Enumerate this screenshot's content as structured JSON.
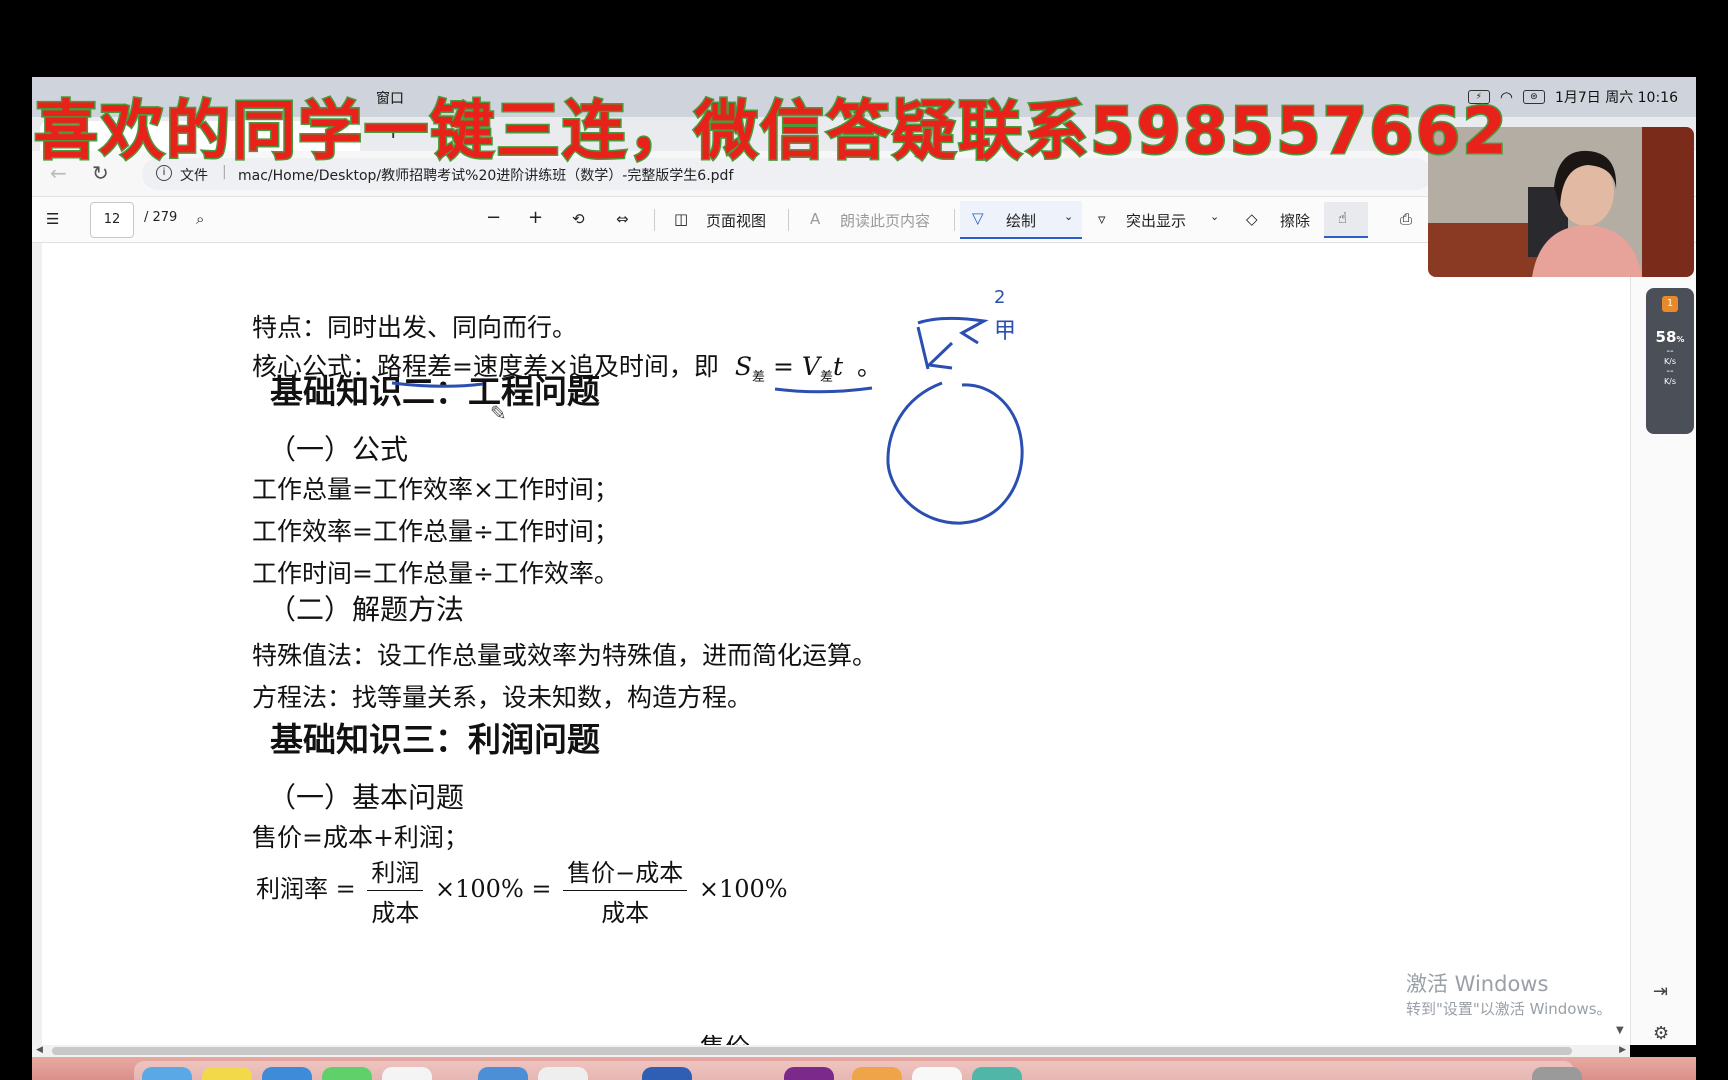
{
  "banner": {
    "text": "喜欢的同学一键三连，微信答疑联系598557662",
    "fill_color": "#e8221b",
    "outline_color": "#4a9a3c"
  },
  "menubar": {
    "window_menu": "窗口",
    "status_icons": [
      "battery-icon",
      "wifi-icon",
      "control-center-icon"
    ],
    "datetime": "1月7日 周六 10:16"
  },
  "browser": {
    "file_label": "文件",
    "url": "mac/Home/Desktop/教师招聘考试%20进阶讲练班（数学）-完整版学生6.pdf"
  },
  "pdf_toolbar": {
    "current_page": "12",
    "total_pages": "/ 279",
    "page_view": "页面视图",
    "read_aloud": "朗读此页内容",
    "draw": "绘制",
    "highlight": "突出显示",
    "erase": "擦除"
  },
  "document": {
    "feature_line": "特点：同时出发、同向而行。",
    "core_formula_prefix": "核心公式：",
    "core_formula_underlined": "路程差",
    "core_formula_rest": "=速度差×追及时间，即",
    "core_formula_math_S": "S",
    "core_formula_math_sub": "差",
    "core_formula_math_eq": " = V",
    "core_formula_math_sub2": "差",
    "core_formula_math_t": "t",
    "core_formula_end": "。",
    "section2_title": "基础知识二：工程问题",
    "s2_sub1": "（一）公式",
    "s2_line1": "工作总量=工作效率×工作时间；",
    "s2_line2": "工作效率=工作总量÷工作时间；",
    "s2_line3": "工作时间=工作总量÷工作效率。",
    "s2_sub2": "（二）解题方法",
    "s2_line4": "特殊值法：设工作总量或效率为特殊值，进而简化运算。",
    "s2_line5": "方程法：找等量关系，设未知数，构造方程。",
    "section3_title": "基础知识三：利润问题",
    "s3_sub1": "（一）基本问题",
    "s3_line1": "售价=成本+利润；",
    "profit_rate_label": "利润率 =",
    "frac1_num": "利润",
    "frac1_den": "成本",
    "times_100_1": "×100% =",
    "frac2_num": "售价−成本",
    "frac2_den": "成本",
    "times_100_2": "×100%",
    "cut_text": "售价"
  },
  "annotation": {
    "ink_color": "#2a4fb0",
    "label_2": "2",
    "label_jia": "甲"
  },
  "speed_widget": {
    "badge": "1",
    "percent": "58",
    "percent_unit": "%",
    "up": "--",
    "up_unit": "K/s",
    "down": "--",
    "down_unit": "K/s"
  },
  "watermark": {
    "line1": "激活 Windows",
    "line2": "转到\"设置\"以激活 Windows。"
  }
}
